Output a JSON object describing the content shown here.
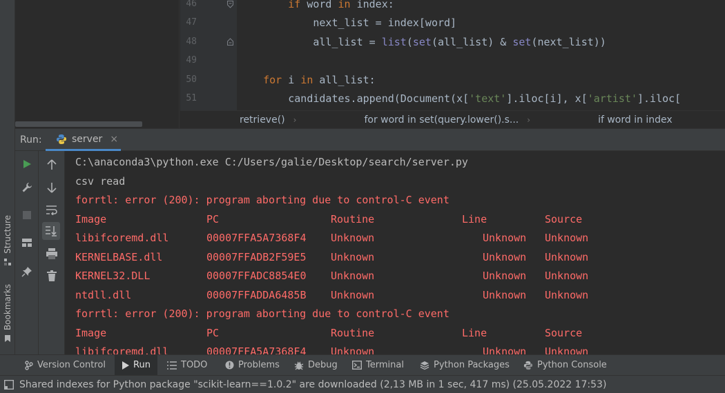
{
  "colors": {
    "editor_bg": "#2b2b2b",
    "panel_bg": "#3c3f41",
    "keyword": "#cc7832",
    "builtin": "#8888c6",
    "string": "#6a8759",
    "error_text": "#ff6b68",
    "accent": "#4a88c7",
    "run_green": "#499c54"
  },
  "left_strip": {
    "structure_label": "Structure",
    "bookmarks_label": "Bookmarks"
  },
  "editor": {
    "lines": [
      {
        "num": "46",
        "indent": "        ",
        "tokens": [
          {
            "t": "if",
            "c": "kw"
          },
          {
            "t": " word ",
            "c": ""
          },
          {
            "t": "in",
            "c": "kw"
          },
          {
            "t": " index:",
            "c": ""
          }
        ]
      },
      {
        "num": "47",
        "indent": "            ",
        "tokens": [
          {
            "t": "next_list = index[word]",
            "c": ""
          }
        ]
      },
      {
        "num": "48",
        "indent": "            ",
        "tokens": [
          {
            "t": "all_list = ",
            "c": ""
          },
          {
            "t": "list",
            "c": "bi"
          },
          {
            "t": "(",
            "c": ""
          },
          {
            "t": "set",
            "c": "bi"
          },
          {
            "t": "(all_list) & ",
            "c": ""
          },
          {
            "t": "set",
            "c": "bi"
          },
          {
            "t": "(next_list))",
            "c": ""
          }
        ]
      },
      {
        "num": "49",
        "indent": "",
        "tokens": []
      },
      {
        "num": "50",
        "indent": "    ",
        "tokens": [
          {
            "t": "for",
            "c": "kw"
          },
          {
            "t": " i ",
            "c": ""
          },
          {
            "t": "in",
            "c": "kw"
          },
          {
            "t": " all_list:",
            "c": ""
          }
        ]
      },
      {
        "num": "51",
        "indent": "        ",
        "tokens": [
          {
            "t": "candidates.append(Document(x[",
            "c": ""
          },
          {
            "t": "'text'",
            "c": "str"
          },
          {
            "t": "].iloc[i], x[",
            "c": ""
          },
          {
            "t": "'artist'",
            "c": "str"
          },
          {
            "t": "].iloc[",
            "c": ""
          }
        ]
      }
    ],
    "breadcrumbs": [
      "retrieve()",
      "for word in set(query.lower().s...",
      "if word in index"
    ]
  },
  "run_panel": {
    "label": "Run:",
    "tab_name": "server",
    "tab_close": "×"
  },
  "console": {
    "lines": [
      {
        "type": "normal",
        "text": "C:\\anaconda3\\python.exe C:/Users/galie/Desktop/search/server.py"
      },
      {
        "type": "normal",
        "text": "csv read"
      },
      {
        "type": "error",
        "text": "forrtl: error (200): program aborting due to control-C event"
      },
      {
        "type": "table",
        "cols": [
          "Image",
          "PC",
          "Routine",
          "Line",
          "Source"
        ]
      },
      {
        "type": "table",
        "cols": [
          "libifcoremd.dll",
          "00007FFA5A7368F4",
          "Unknown",
          "Unknown",
          "Unknown"
        ]
      },
      {
        "type": "table",
        "cols": [
          "KERNELBASE.dll",
          "00007FFADB2F59E5",
          "Unknown",
          "Unknown",
          "Unknown"
        ]
      },
      {
        "type": "table",
        "cols": [
          "KERNEL32.DLL",
          "00007FFADC8854E0",
          "Unknown",
          "Unknown",
          "Unknown"
        ]
      },
      {
        "type": "table",
        "cols": [
          "ntdll.dll",
          "00007FFADDA6485B",
          "Unknown",
          "Unknown",
          "Unknown"
        ]
      },
      {
        "type": "error",
        "text": "forrtl: error (200): program aborting due to control-C event"
      },
      {
        "type": "table",
        "cols": [
          "Image",
          "PC",
          "Routine",
          "Line",
          "Source"
        ]
      },
      {
        "type": "table",
        "cols": [
          "libifcoremd.dll",
          "00007FFA5A7368F4",
          "Unknown",
          "Unknown",
          "Unknown"
        ]
      }
    ]
  },
  "bottom_tabs": [
    {
      "label": "Version Control",
      "icon": "branch-icon",
      "active": false
    },
    {
      "label": "Run",
      "icon": "run-icon",
      "active": true
    },
    {
      "label": "TODO",
      "icon": "list-icon",
      "active": false
    },
    {
      "label": "Problems",
      "icon": "problems-icon",
      "active": false
    },
    {
      "label": "Debug",
      "icon": "bug-icon",
      "active": false
    },
    {
      "label": "Terminal",
      "icon": "terminal-icon",
      "active": false
    },
    {
      "label": "Python Packages",
      "icon": "packages-icon",
      "active": false
    },
    {
      "label": "Python Console",
      "icon": "python-icon",
      "active": false
    }
  ],
  "status_bar": {
    "message": "Shared indexes for Python package \"scikit-learn==1.0.2\" are downloaded (2,13 MB in 1 sec, 417 ms) (25.05.2022 17:53)"
  }
}
